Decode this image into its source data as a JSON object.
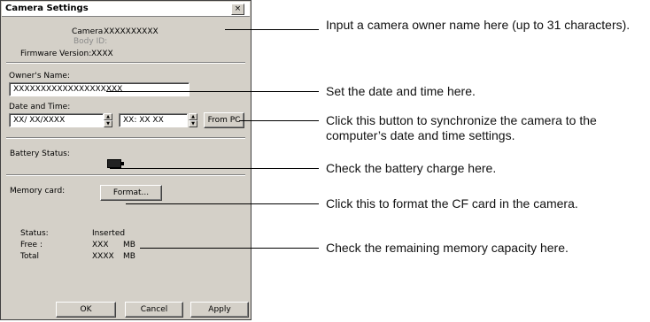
{
  "dialog": {
    "title": "Camera Settings",
    "close_glyph": "×",
    "camera_label": "Camera",
    "camera_value": "XXXXXXXXXX",
    "body_id_label": "Body ID:",
    "firmware_label": "Firmware Version:",
    "firmware_value": "XXXX",
    "owner_label": "Owner's Name:",
    "owner_value": "XXXXXXXXXXXXXXXXXXXX",
    "datetime_label": "Date and Time:",
    "date_value": "XX/ XX/XXXX",
    "time_value": "XX:  XX  XX",
    "from_pc_button": "From PC",
    "battery_label": "Battery Status:",
    "memory_label": "Memory card:",
    "format_button": "Format...",
    "status_label": "Status:",
    "status_value": "Inserted",
    "free_label": "Free :",
    "free_value": "XXX",
    "free_unit": "MB",
    "total_label": "Total",
    "total_value": "XXXX",
    "total_unit": "MB",
    "ok_button": "OK",
    "cancel_button": "Cancel",
    "apply_button": "Apply"
  },
  "callouts": [
    "Input a camera owner name here (up to 31 characters).",
    "Set the date and time here.",
    "Click this button to synchronize the camera to the computer’s date and time settings.",
    "Check the battery charge here.",
    "Click this to format the CF card in the camera.",
    "Check the remaining memory capacity here."
  ],
  "colors": {
    "dialog_face": "#d4d0c8",
    "field_bg": "#ffffff"
  }
}
